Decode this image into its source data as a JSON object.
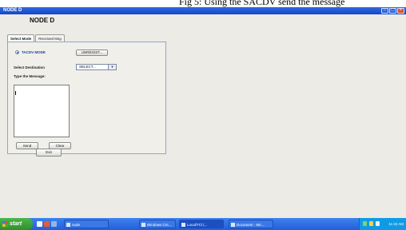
{
  "caption": "Fig 5: Using the SACDV send the message",
  "window": {
    "title": "NODE D"
  },
  "header": {
    "title": "NODE D"
  },
  "tabs": [
    {
      "label": "Select Mode",
      "active": true
    },
    {
      "label": "Received Msg",
      "active": false
    }
  ],
  "form": {
    "mode_label": "TACDV MODE",
    "mode_button": "UNREGIST...",
    "destination_label": "Select Destination",
    "destination_value": "SELECT...",
    "message_label": "Type the Message:",
    "message_value": "",
    "send_label": "Send",
    "clear_label": "Clear"
  },
  "exit_label": "Exit",
  "taskbar": {
    "start_label": "start",
    "tasks": [
      {
        "label": "node",
        "active": false
      },
      {
        "label": "Windows Cm...",
        "active": false
      },
      {
        "label": "Local/TCl (...",
        "active": true
      },
      {
        "label": "Document - Mic...",
        "active": false
      }
    ],
    "clock": "11:32 AM"
  },
  "colors": {
    "titlebar": "#1f55d6",
    "taskbar": "#245edb",
    "start": "#3a9d3a",
    "window_bg": "#ecebe6"
  }
}
